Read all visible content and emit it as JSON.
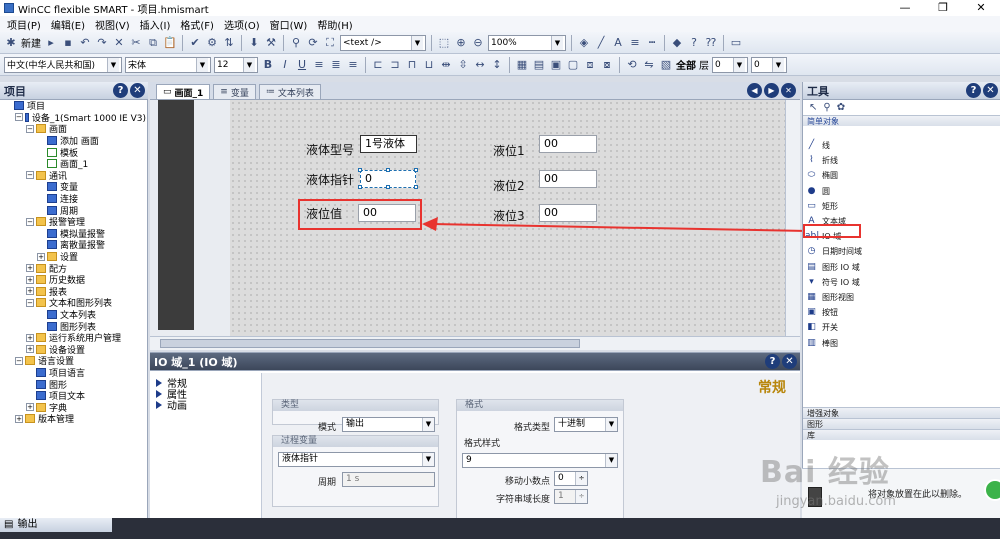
{
  "window": {
    "title": "WinCC flexible SMART - 项目.hmismart",
    "controls": {
      "minimize": "—",
      "maximize": "❐",
      "close": "✕"
    }
  },
  "menu": [
    "项目(P)",
    "编辑(E)",
    "视图(V)",
    "插入(I)",
    "格式(F)",
    "选项(O)",
    "窗口(W)",
    "帮助(H)"
  ],
  "toolbar": {
    "new_label": "新建",
    "text_combo": "<text />",
    "zoom": "100%",
    "language": "中文(中华人民共和国)",
    "font": "宋体",
    "size": "12",
    "bold": "B",
    "italic": "I",
    "underline": "U",
    "all": "全部",
    "layer_label": "层",
    "layer_a": "0",
    "layer_b": "0"
  },
  "project_panel": {
    "title": "项目",
    "tree": [
      {
        "label": "项目",
        "depth": 0,
        "exp": "",
        "icon": "blue"
      },
      {
        "label": "设备_1(Smart 1000 IE V3)",
        "depth": 1,
        "exp": "−",
        "icon": "blue"
      },
      {
        "label": "画面",
        "depth": 2,
        "exp": "−",
        "icon": "folder"
      },
      {
        "label": "添加 画面",
        "depth": 3,
        "exp": "",
        "icon": "blue"
      },
      {
        "label": "模板",
        "depth": 3,
        "exp": "",
        "icon": "green"
      },
      {
        "label": "画面_1",
        "depth": 3,
        "exp": "",
        "icon": "green"
      },
      {
        "label": "通讯",
        "depth": 2,
        "exp": "−",
        "icon": "folder"
      },
      {
        "label": "变量",
        "depth": 3,
        "exp": "",
        "icon": "blue"
      },
      {
        "label": "连接",
        "depth": 3,
        "exp": "",
        "icon": "blue"
      },
      {
        "label": "周期",
        "depth": 3,
        "exp": "",
        "icon": "blue"
      },
      {
        "label": "报警管理",
        "depth": 2,
        "exp": "−",
        "icon": "folder"
      },
      {
        "label": "模拟量报警",
        "depth": 3,
        "exp": "",
        "icon": "blue"
      },
      {
        "label": "离散量报警",
        "depth": 3,
        "exp": "",
        "icon": "blue"
      },
      {
        "label": "设置",
        "depth": 3,
        "exp": "+",
        "icon": "folder"
      },
      {
        "label": "配方",
        "depth": 2,
        "exp": "+",
        "icon": "folder"
      },
      {
        "label": "历史数据",
        "depth": 2,
        "exp": "+",
        "icon": "folder"
      },
      {
        "label": "报表",
        "depth": 2,
        "exp": "+",
        "icon": "folder"
      },
      {
        "label": "文本和图形列表",
        "depth": 2,
        "exp": "−",
        "icon": "folder"
      },
      {
        "label": "文本列表",
        "depth": 3,
        "exp": "",
        "icon": "blue"
      },
      {
        "label": "图形列表",
        "depth": 3,
        "exp": "",
        "icon": "blue"
      },
      {
        "label": "运行系统用户管理",
        "depth": 2,
        "exp": "+",
        "icon": "folder"
      },
      {
        "label": "设备设置",
        "depth": 2,
        "exp": "+",
        "icon": "folder"
      },
      {
        "label": "语言设置",
        "depth": 1,
        "exp": "−",
        "icon": "folder"
      },
      {
        "label": "项目语言",
        "depth": 2,
        "exp": "",
        "icon": "blue"
      },
      {
        "label": "图形",
        "depth": 2,
        "exp": "",
        "icon": "blue"
      },
      {
        "label": "项目文本",
        "depth": 2,
        "exp": "",
        "icon": "blue"
      },
      {
        "label": "字典",
        "depth": 2,
        "exp": "+",
        "icon": "folder"
      },
      {
        "label": "版本管理",
        "depth": 1,
        "exp": "+",
        "icon": "folder"
      }
    ]
  },
  "editor": {
    "tabs": [
      "画面_1",
      "变量",
      "文本列表"
    ],
    "labels": {
      "liquid_type": "液体型号",
      "liquid_pointer": "液体指针",
      "liquid_value": "液位值",
      "level1": "液位1",
      "level2": "液位2",
      "level3": "液位3"
    },
    "fields": {
      "liquid_type": "1号液体",
      "liquid_pointer": "0",
      "liquid_value": "00",
      "level1": "00",
      "level2": "00",
      "level3": "00"
    }
  },
  "properties": {
    "title": "IO 域_1 (IO 域)",
    "section_title": "常规",
    "nav": [
      "常规",
      "属性",
      "动画"
    ],
    "type_group": "类型",
    "mode_label": "模式",
    "mode_value": "输出",
    "process_group": "过程变量",
    "process_value": "液体指针",
    "cycle_label": "周期",
    "cycle_value": "1 s",
    "format_group": "格式",
    "format_type_label": "格式类型",
    "format_type_value": "十进制",
    "format_pattern_label": "格式样式",
    "format_pattern_value": "9",
    "decimal_label": "移动小数点",
    "decimal_value": "0",
    "length_label": "字符串域长度",
    "length_value": "1"
  },
  "tools": {
    "title": "工具",
    "section": "简单对象",
    "items": [
      {
        "label": "线",
        "icon": "╱"
      },
      {
        "label": "折线",
        "icon": "⌇"
      },
      {
        "label": "椭圆",
        "icon": "⬭"
      },
      {
        "label": "圆",
        "icon": "●"
      },
      {
        "label": "矩形",
        "icon": "▭"
      },
      {
        "label": "文本域",
        "icon": "A"
      },
      {
        "label": "IO 域",
        "icon": "ab|"
      },
      {
        "label": "日期时间域",
        "icon": "◷"
      },
      {
        "label": "图形 IO 域",
        "icon": "▤"
      },
      {
        "label": "符号 IO 域",
        "icon": "▾"
      },
      {
        "label": "图形视图",
        "icon": "▦"
      },
      {
        "label": "按钮",
        "icon": "▣"
      },
      {
        "label": "开关",
        "icon": "◧"
      },
      {
        "label": "棒图",
        "icon": "▥"
      }
    ],
    "sections2": [
      "增强对象",
      "图形",
      "库"
    ],
    "delete_hint": "将对象放置在此以删除。"
  },
  "output": {
    "title": "输出"
  },
  "watermark": {
    "main": "Bai 经验",
    "sub": "jingyan.baidu.com"
  },
  "colors": {
    "annotation": "#e8332f",
    "accent": "#1f3d7a"
  }
}
